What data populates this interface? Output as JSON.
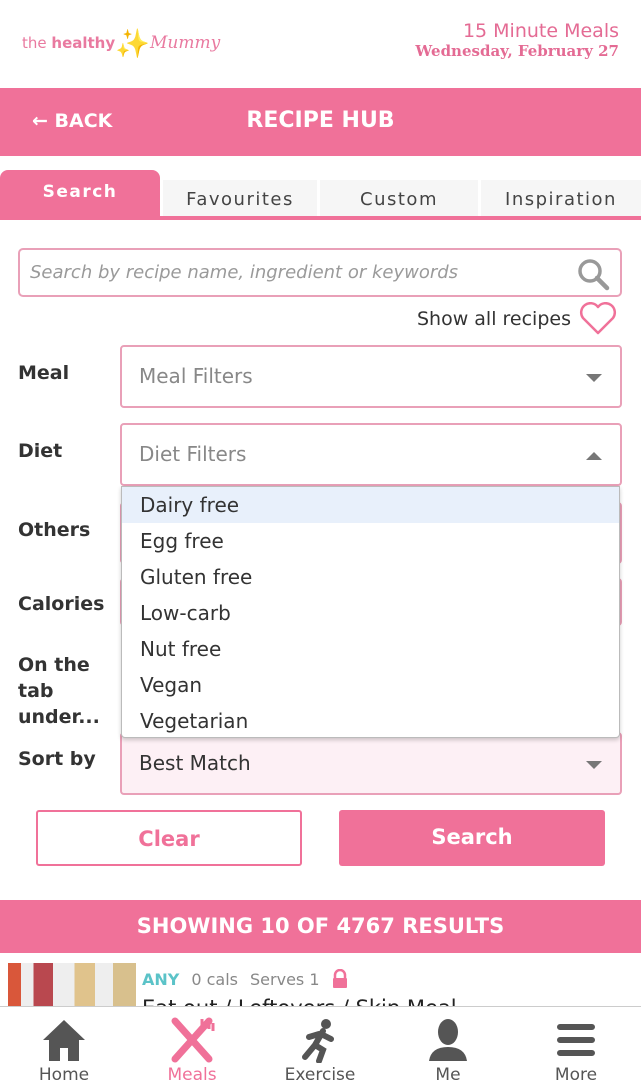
{
  "header": {
    "logo_text": "the healthy Mummy",
    "title": "15 Minute Meals",
    "date": "Wednesday, February 27"
  },
  "bar": {
    "back_label": "BACK",
    "title": "RECIPE HUB"
  },
  "tabs": [
    {
      "label": "Search",
      "active": true
    },
    {
      "label": "Favourites"
    },
    {
      "label": "Custom"
    },
    {
      "label": "Inspiration"
    }
  ],
  "search": {
    "placeholder": "Search by recipe name, ingredient or keywords",
    "value": ""
  },
  "show_all": "Show all recipes",
  "filters": {
    "meal": {
      "label": "Meal",
      "placeholder": "Meal Filters"
    },
    "diet": {
      "label": "Diet",
      "placeholder": "Diet Filters",
      "open": true,
      "options": [
        "Dairy free",
        "Egg free",
        "Gluten free",
        "Low-carb",
        "Nut free",
        "Vegan",
        "Vegetarian"
      ],
      "highlighted": "Dairy free"
    },
    "others": {
      "label": "Others"
    },
    "calories": {
      "label": "Calories"
    },
    "on_tab": {
      "label": "On the tab under..."
    },
    "sort": {
      "label": "Sort by",
      "value": "Best Match"
    }
  },
  "buttons": {
    "clear": "Clear",
    "search": "Search"
  },
  "results": "SHOWING 10 OF 4767 RESULTS",
  "recipe": {
    "meal_type": "ANY",
    "calories": "0 cals",
    "serves": "Serves 1",
    "title": "Eat out / Leftovers / Skip Meal",
    "locked": true
  },
  "nav": [
    {
      "label": "Home",
      "icon": "home-icon"
    },
    {
      "label": "Meals",
      "icon": "cutlery-icon",
      "active": true
    },
    {
      "label": "Exercise",
      "icon": "running-icon"
    },
    {
      "label": "Me",
      "icon": "person-icon"
    },
    {
      "label": "More",
      "icon": "menu-icon"
    }
  ],
  "colors": {
    "accent": "#f07199",
    "teal": "#5bc3c8"
  }
}
